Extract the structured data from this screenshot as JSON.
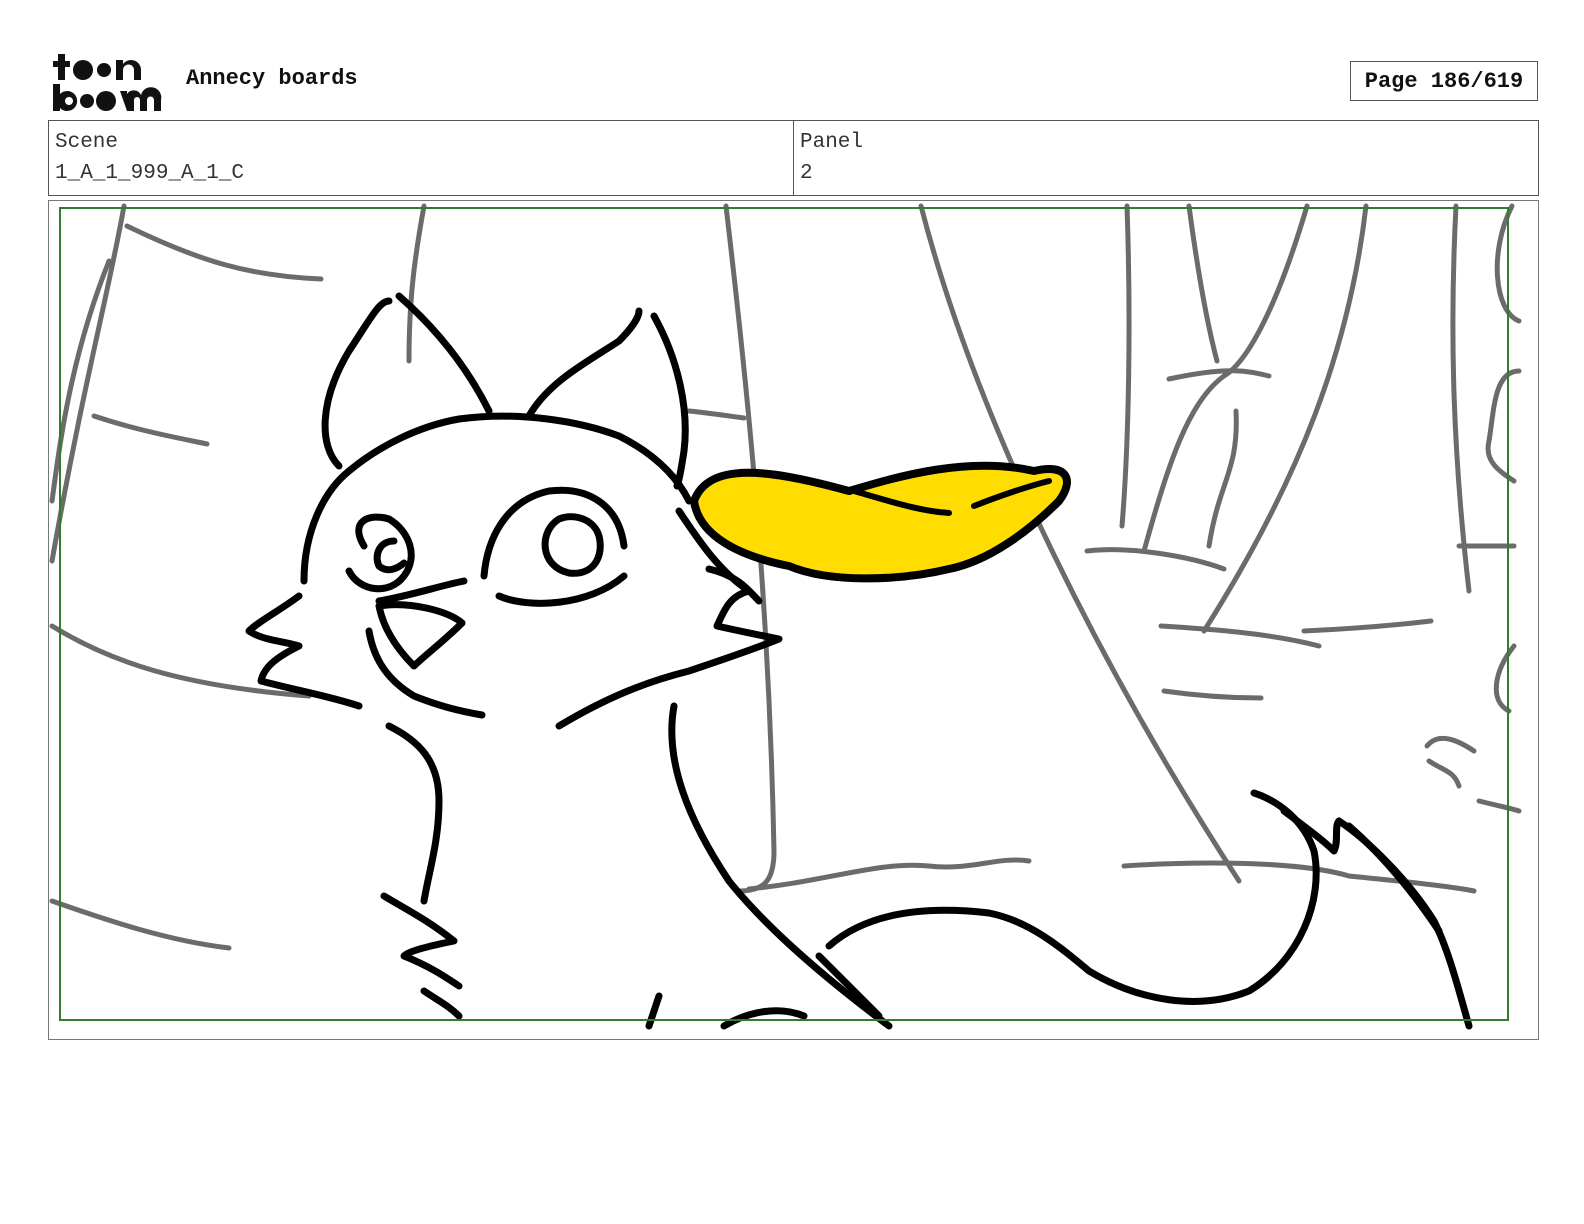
{
  "header": {
    "logo_text": "toon boom",
    "title": "Annecy boards",
    "page_label": "Page 186/619"
  },
  "info": {
    "scene_label": "Scene",
    "scene_value": "1_A_1_999_A_1_C",
    "panel_label": "Panel",
    "panel_value": "2"
  },
  "colors": {
    "safe_area": "#2e7d32",
    "ink": "#000000",
    "background_lines": "#6b6b6b",
    "leaf_fill": "#ffdd00"
  }
}
